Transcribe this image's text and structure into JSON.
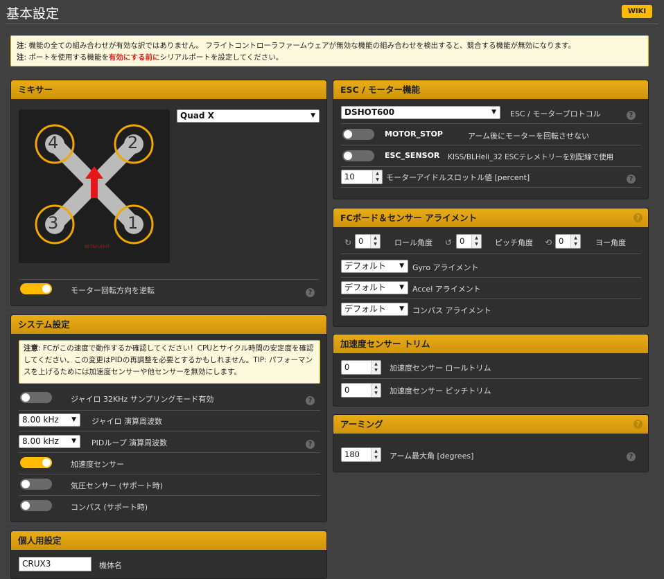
{
  "page": {
    "title": "基本設定",
    "wiki": "WIKI"
  },
  "note": {
    "line1_prefix": "注",
    "line1": ": 機能の全ての組み合わせが有効な訳ではありません。 フライトコントローラファームウェアが無効な機能の組み合わせを検出すると、競合する機能が無効になります。",
    "line2_prefix": "注",
    "line2_a": ": ポートを使用する機能を",
    "line2_red": "有効にする前に",
    "line2_b": "シリアルポートを設定してください。"
  },
  "mixer": {
    "header": "ミキサー",
    "preset": "Quad X",
    "motors": [
      "4",
      "2",
      "3",
      "1"
    ],
    "reverse_label": "モーター回転方向を逆転",
    "reverse_on": true
  },
  "system": {
    "header": "システム設定",
    "warn_prefix": "注意",
    "warn": ": FCがこの速度で動作するか確認してください！CPUとサイクル時間の安定度を確認してください。この変更はPIDの再調整を必要とするかもしれません。TIP: パフォーマンスを上げるためには加速度センサーや他センサーを無効にします。",
    "gyro32_label": "ジャイロ 32KHz サンプリングモード有効",
    "gyro_freq": "8.00 kHz",
    "gyro_freq_label": "ジャイロ 演算周波数",
    "pid_freq": "8.00 kHz",
    "pid_freq_label": "PIDループ 演算周波数",
    "acc_label": "加速度センサー",
    "baro_label": "気圧センサー (サポート時)",
    "mag_label": "コンパス (サポート時)"
  },
  "personal": {
    "header": "個人用設定",
    "craft_name": "CRUX3",
    "craft_label": "機体名"
  },
  "esc": {
    "header": "ESC / モーター機能",
    "protocol": "DSHOT600",
    "protocol_label": "ESC / モータープロトコル",
    "motor_stop": "MOTOR_STOP",
    "motor_stop_desc": "アーム後にモーターを回転させない",
    "esc_sensor": "ESC_SENSOR",
    "esc_sensor_desc": "KISS/BLHeli_32 ESCテレメトリーを別配線で使用",
    "idle": "10",
    "idle_label": "モーターアイドルスロットル値 [percent]"
  },
  "align": {
    "header": "FCボード＆センサー アライメント",
    "roll": "0",
    "roll_label": "ロール角度",
    "pitch": "0",
    "pitch_label": "ピッチ角度",
    "yaw": "0",
    "yaw_label": "ヨー角度",
    "default": "デフォルト",
    "gyro_label": "Gyro アライメント",
    "accel_label": "Accel アライメント",
    "compass_label": "コンパス アライメント"
  },
  "trim": {
    "header": "加速度センサー トリム",
    "roll": "0",
    "roll_label": "加速度センサー ロールトリム",
    "pitch": "0",
    "pitch_label": "加速度センサー ピッチトリム"
  },
  "arming": {
    "header": "アーミング",
    "angle": "180",
    "angle_label": "アーム最大角 [degrees]"
  },
  "help": "?"
}
